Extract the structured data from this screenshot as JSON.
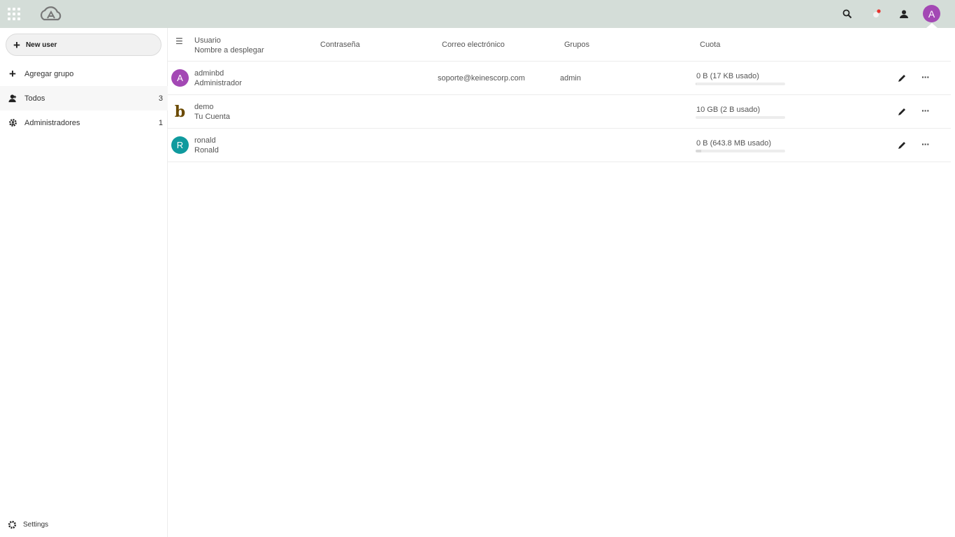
{
  "header": {
    "apps_icon": "apps-grid-icon",
    "logo": "cloud-logo",
    "search_icon": "search-icon",
    "notifications_icon": "notifications-icon",
    "contacts_icon": "contacts-icon",
    "avatar_letter": "A",
    "avatar_color": "#a348b4",
    "notification_dot_color": "#e9322d",
    "bar_color": "#d4ddd8"
  },
  "sidebar": {
    "new_user_label": "New user",
    "add_group_label": "Agregar grupo",
    "groups": [
      {
        "label": "Todos",
        "count": "3",
        "icon": "user-icon"
      },
      {
        "label": "Administradores",
        "count": "1",
        "icon": "admin-gear-icon"
      }
    ],
    "settings_label": "Settings"
  },
  "table": {
    "columns": {
      "user": "Usuario",
      "display_name": "Nombre a desplegar",
      "password": "Contraseña",
      "email": "Correo electrónico",
      "groups": "Grupos",
      "quota": "Cuota"
    },
    "rows": [
      {
        "avatar": "A",
        "avatar_color": "#a348b4",
        "username": "adminbd",
        "display_name": "Administrador",
        "email": "soporte@keinescorp.com",
        "groups": "admin",
        "quota": "0 B (17 KB usado)",
        "quota_fill": 0.01
      },
      {
        "avatar": "b",
        "avatar_color": "transparent",
        "username": "demo",
        "display_name": "Tu Cuenta",
        "email": "",
        "groups": "",
        "quota": "10 GB (2 B usado)",
        "quota_fill": 0.0
      },
      {
        "avatar": "R",
        "avatar_color": "#0f9a9e",
        "username": "ronald",
        "display_name": "Ronald",
        "email": "",
        "groups": "",
        "quota": "0 B (643.8 MB usado)",
        "quota_fill": 0.06
      }
    ]
  }
}
